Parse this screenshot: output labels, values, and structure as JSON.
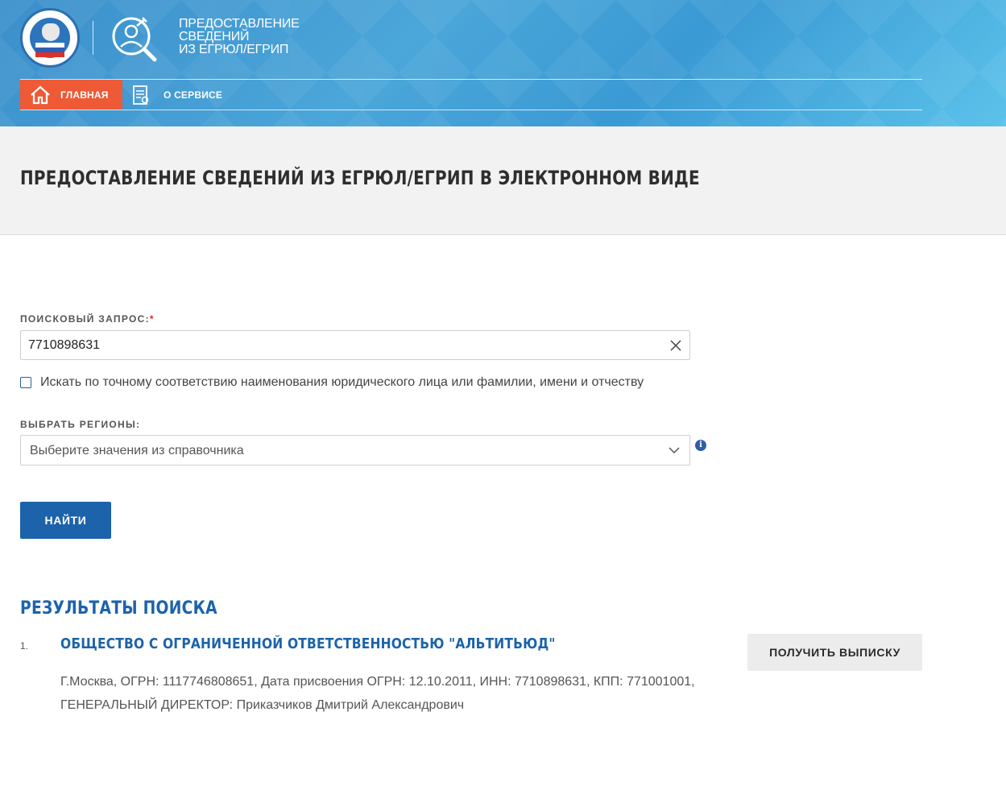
{
  "header": {
    "service_title_lines": [
      "ПРЕДОСТАВЛЕНИЕ",
      "СВЕДЕНИЙ",
      "ИЗ ЕГРЮЛ/ЕГРИП"
    ],
    "nav": {
      "home": "ГЛАВНАЯ",
      "about": "О СЕРВИСЕ"
    },
    "accent_color": "#ee5a36"
  },
  "page_title": "ПРЕДОСТАВЛЕНИЕ СВЕДЕНИЙ ИЗ ЕГРЮЛ/ЕГРИП В ЭЛЕКТРОННОМ ВИДЕ",
  "form": {
    "query_label": "ПОИСКОВЫЙ ЗАПРОС:",
    "required_mark": "*",
    "query_value": "7710898631",
    "exact_match_label": "Искать по точному соответствию наименования юридического лица или фамилии, имени и отчеству",
    "exact_match_checked": false,
    "regions_label": "ВЫБРАТЬ РЕГИОНЫ:",
    "regions_placeholder": "Выберите значения из справочника",
    "info_glyph": "i",
    "find_button": "НАЙТИ",
    "primary_color": "#1c63ab"
  },
  "results": {
    "title": "РЕЗУЛЬТАТЫ ПОИСКА",
    "items": [
      {
        "number": "1.",
        "name": "ОБЩЕСТВО С ОГРАНИЧЕННОЙ ОТВЕТСТВЕННОСТЬЮ \"АЛЬТИТЬЮД\"",
        "details_line1": "Г.Москва, ОГРН: 1117746808651, Дата присвоения ОГРН: 12.10.2011, ИНН: 7710898631, КПП: 771001001,",
        "details_line2": "ГЕНЕРАЛЬНЫЙ ДИРЕКТОР: Приказчиков Дмитрий Александрович",
        "action": "ПОЛУЧИТЬ ВЫПИСКУ"
      }
    ]
  }
}
